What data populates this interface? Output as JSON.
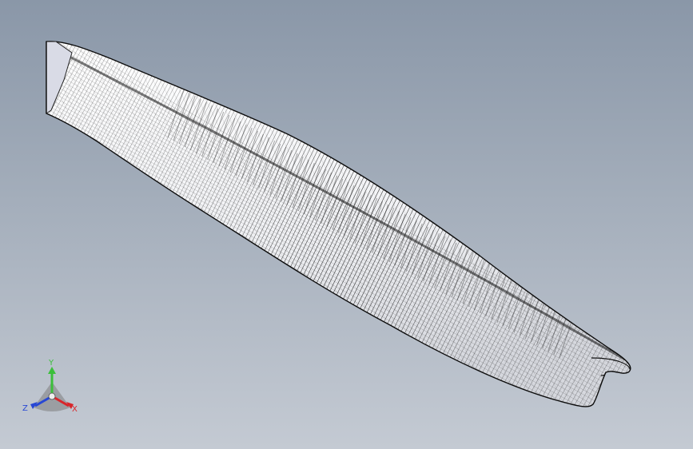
{
  "viewport": {
    "background_top": "#8a97a8",
    "background_bottom": "#c4cad3"
  },
  "model": {
    "render_style": "wireframe-mesh",
    "mesh_color": "#111111",
    "surface_color": "#ffffff",
    "transom_color": "#d9dbe6"
  },
  "triad": {
    "x_label": "X",
    "y_label": "Y",
    "z_label": "Z",
    "x_color": "#d8262b",
    "y_color": "#3bbf3b",
    "z_color": "#2747d4"
  }
}
